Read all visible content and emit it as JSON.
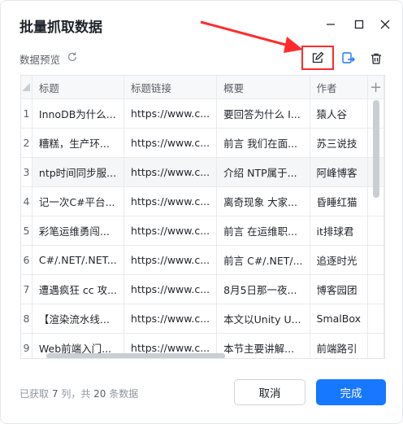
{
  "dialog": {
    "title": "批量抓取数据"
  },
  "subheader": {
    "label": "数据预览"
  },
  "table": {
    "columns": [
      "标题",
      "标题链接",
      "概要",
      "作者"
    ],
    "rows": [
      {
        "idx": "1",
        "cells": [
          "InnoDB为什么...",
          "https://www.c...",
          "要回答为什么 I...",
          "猿人谷"
        ]
      },
      {
        "idx": "2",
        "cells": [
          "糟糕，生产环...",
          "https://www.c...",
          "前言 我们在面...",
          "苏三说技"
        ]
      },
      {
        "idx": "3",
        "cells": [
          "ntp时间同步服...",
          "https://www.c...",
          "介绍 NTP属于...",
          "阿峰博客"
        ]
      },
      {
        "idx": "4",
        "cells": [
          "记一次C#平台...",
          "https://www.c...",
          "离奇现象 大家...",
          "昏睡红猫"
        ]
      },
      {
        "idx": "5",
        "cells": [
          "彩笔运维勇闯...",
          "https://www.c...",
          "前言 在运维职...",
          "it排球君"
        ]
      },
      {
        "idx": "6",
        "cells": [
          "C#/.NET/.NET...",
          "https://www.c...",
          "前言 C#/.NET/...",
          "追逐时光"
        ]
      },
      {
        "idx": "7",
        "cells": [
          "遭遇疯狂 cc 攻...",
          "https://www.c...",
          "8月5日那一夜...",
          "博客园团"
        ]
      },
      {
        "idx": "8",
        "cells": [
          "【渲染流水线...",
          "https://www.c...",
          "本文以Unity U...",
          "SmalBox"
        ]
      },
      {
        "idx": "9",
        "cells": [
          "Web前端入门...",
          "https://www.c...",
          "本节主要讲解...",
          "前端路引"
        ]
      }
    ]
  },
  "footer": {
    "prefix": "已获取",
    "cols": "7",
    "mid": "列，共",
    "rows": "20",
    "suffix": "条数据",
    "cancel": "取消",
    "ok": "完成"
  },
  "colors": {
    "accent": "#1677ff",
    "highlight": "#ff2a2a"
  }
}
